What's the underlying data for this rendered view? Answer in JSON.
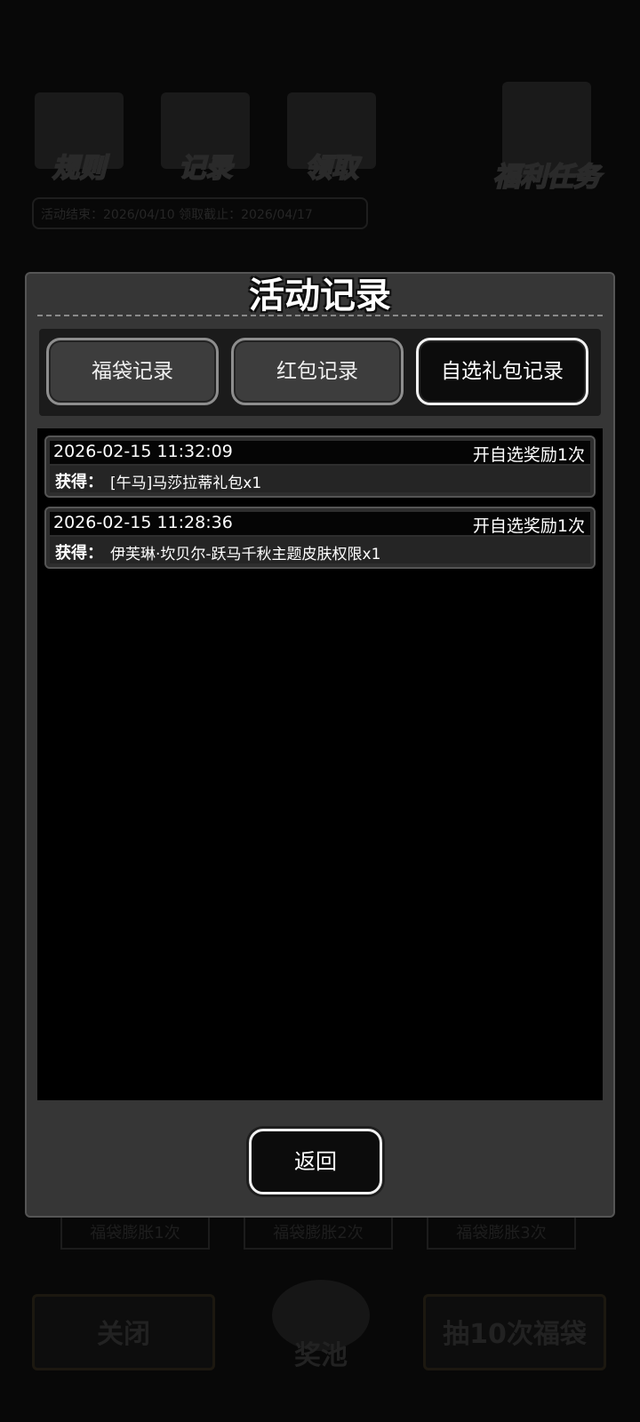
{
  "background": {
    "icons": [
      {
        "label": "规则",
        "icon": "rulebook-icon"
      },
      {
        "label": "记录",
        "icon": "scroll-pen-icon"
      },
      {
        "label": "领取",
        "icon": "chest-icon"
      },
      {
        "label": "福利任务",
        "icon": "target-pillar-icon"
      }
    ],
    "event_dates": "活动结束：2026/04/10  领取截止：2026/04/17",
    "expand_buttons": [
      "福袋膨胀1次",
      "福袋膨胀2次",
      "福袋膨胀3次"
    ],
    "close_label": "关闭",
    "pool_label": "奖池",
    "draw_label": "抽10次福袋"
  },
  "modal": {
    "title": "活动记录",
    "tabs": [
      {
        "label": "福袋记录",
        "active": false
      },
      {
        "label": "红包记录",
        "active": false
      },
      {
        "label": "自选礼包记录",
        "active": true
      }
    ],
    "records": [
      {
        "time": "2026-02-15 11:32:09",
        "action": "开自选奖励1次",
        "gain_label": "获得：",
        "item": "[午马]马莎拉蒂礼包x1"
      },
      {
        "time": "2026-02-15 11:28:36",
        "action": "开自选奖励1次",
        "gain_label": "获得：",
        "item": "伊芙琳·坎贝尔-跃马千秋主题皮肤权限x1"
      }
    ],
    "back_label": "返回"
  }
}
